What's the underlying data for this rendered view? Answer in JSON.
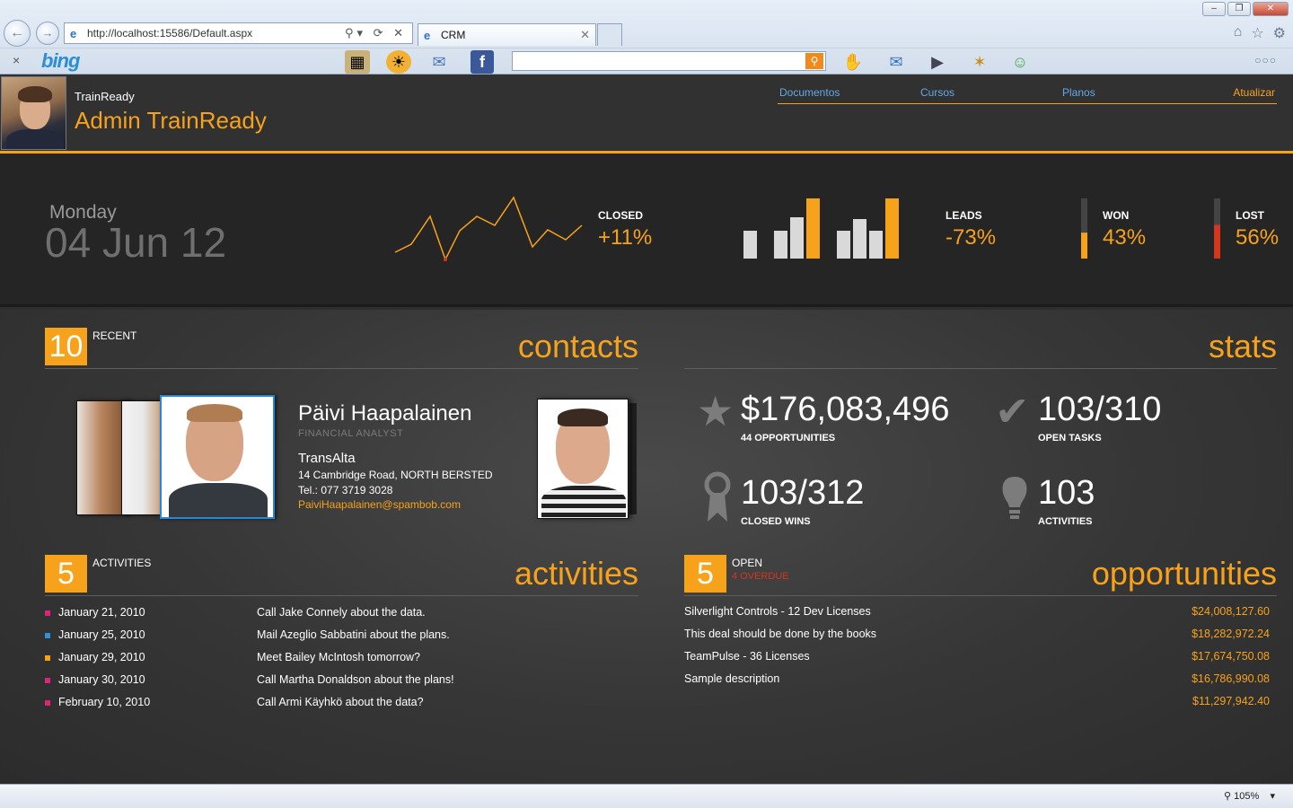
{
  "browser": {
    "address": "http://localhost:15586/Default.aspx",
    "tab_title": "CRM",
    "bing_logo": "bing",
    "window_controls": [
      "–",
      "❐",
      "✕"
    ],
    "zoom": "105%"
  },
  "header": {
    "subtitle": "TrainReady",
    "title": "Admin TrainReady",
    "nav": [
      "Documentos",
      "Cursos",
      "Planos"
    ],
    "refresh": "Atualizar"
  },
  "kpi": {
    "day": "Monday",
    "date": "04 Jun 12",
    "closed": {
      "label": "CLOSED",
      "value": "+11%"
    },
    "leads": {
      "label": "LEADS",
      "value": "-73%"
    },
    "won": {
      "label": "WON",
      "value": "43%",
      "fraction": 0.43
    },
    "lost": {
      "label": "LOST",
      "value": "56%",
      "fraction": 0.56
    },
    "colors": {
      "accent": "#f7a21b",
      "lost": "#d4361d",
      "neutral": "#d9d9d9"
    }
  },
  "contacts": {
    "count": "10",
    "tag": "RECENT",
    "title": "contacts",
    "name": "Päivi Haapalainen",
    "role": "FINANCIAL  ANALYST",
    "company": "TransAlta",
    "address": "14 Cambridge Road, NORTH BERSTED",
    "phone": "Tel.: 077 3719 3028",
    "email": "PaiviHaapalainen@spambob.com"
  },
  "stats": {
    "title": "stats",
    "opportunities": {
      "value": "$176,083,496",
      "label": "44 OPPORTUNITIES",
      "icon": "star-icon"
    },
    "open_tasks": {
      "value": "103/310",
      "label": "OPEN TASKS",
      "icon": "check-icon"
    },
    "closed_wins": {
      "value": "103/312",
      "label": "CLOSED WINS",
      "icon": "ribbon-icon"
    },
    "activities": {
      "value": "103",
      "label": "ACTIVITIES",
      "icon": "bulb-icon"
    }
  },
  "activities": {
    "count": "5",
    "tag": "ACTIVITIES",
    "title": "activities",
    "items": [
      {
        "date": "January 21, 2010",
        "desc": "Call Jake Connely about the data.",
        "color": "#e0237a"
      },
      {
        "date": "January 25, 2010",
        "desc": "Mail Azeglio Sabbatini about the plans.",
        "color": "#2a94d6"
      },
      {
        "date": "January 29, 2010",
        "desc": "Meet Bailey McIntosh tomorrow?",
        "color": "#f7a21b"
      },
      {
        "date": "January 30, 2010",
        "desc": "Call Martha Donaldson about the plans!",
        "color": "#e0237a"
      },
      {
        "date": "February 10, 2010",
        "desc": "Call Armi Käyhkö about the data?",
        "color": "#e0237a"
      }
    ]
  },
  "opportunities": {
    "count": "5",
    "tag": "OPEN",
    "sub": "4 OVERDUE",
    "title": "opportunities",
    "items": [
      {
        "desc": "Silverlight Controls - 12 Dev Licenses",
        "amount": "$24,008,127.60"
      },
      {
        "desc": "This deal should be done by the books",
        "amount": "$18,282,972.24"
      },
      {
        "desc": "TeamPulse - 36 Licenses",
        "amount": "$17,674,750.08"
      },
      {
        "desc": "Sample description",
        "amount": "$16,786,990.08"
      },
      {
        "desc": "",
        "amount": "$11,297,942.40"
      }
    ]
  }
}
